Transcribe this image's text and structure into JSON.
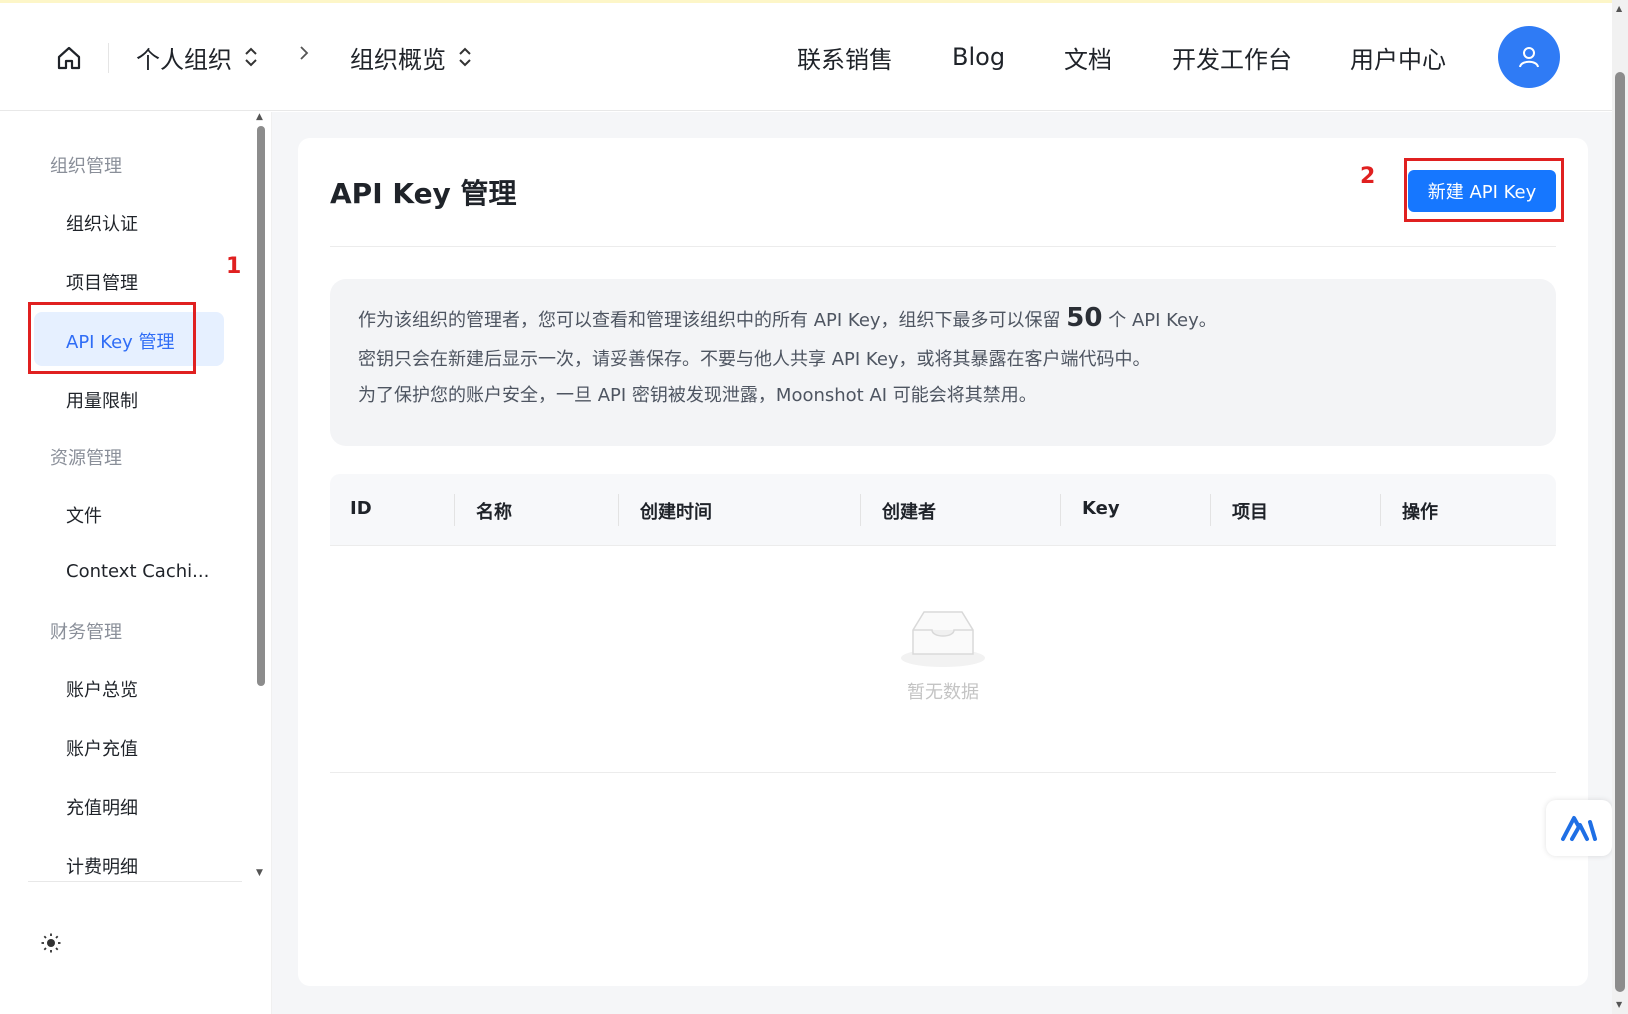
{
  "header": {
    "breadcrumb": [
      {
        "label": "个人组织"
      },
      {
        "label": "组织概览"
      }
    ],
    "nav": [
      "联系销售",
      "Blog",
      "文档",
      "开发工作台",
      "用户中心"
    ]
  },
  "sidebar": {
    "groups": [
      {
        "label": "组织管理",
        "items": [
          "组织认证",
          "项目管理",
          "API Key 管理",
          "用量限制"
        ]
      },
      {
        "label": "资源管理",
        "items": [
          "文件",
          "Context Cachi..."
        ]
      },
      {
        "label": "财务管理",
        "items": [
          "账户总览",
          "账户充值",
          "充值明细",
          "计费明细"
        ]
      }
    ],
    "active_item": "API Key 管理"
  },
  "annotations": {
    "marker_1": "1",
    "marker_2": "2"
  },
  "main": {
    "title": "API Key 管理",
    "new_button_label": "新建 API Key",
    "info": {
      "line1_before": "作为该组织的管理者，您可以查看和管理该组织中的所有 API Key，组织下最多可以保留",
      "line1_number": "50",
      "line1_after": "个 API Key。",
      "line2": "密钥只会在新建后显示一次，请妥善保存。不要与他人共享 API Key，或将其暴露在客户端代码中。",
      "line3": "为了保护您的账户安全，一旦 API 密钥被发现泄露，Moonshot AI 可能会将其禁用。"
    },
    "table": {
      "columns": [
        "ID",
        "名称",
        "创建时间",
        "创建者",
        "Key",
        "项目",
        "操作"
      ],
      "rows": [],
      "empty_text": "暂无数据"
    }
  },
  "colors": {
    "accent": "#1677ff",
    "annotation_red": "#e02020",
    "active_bg": "#e6f0ff"
  }
}
